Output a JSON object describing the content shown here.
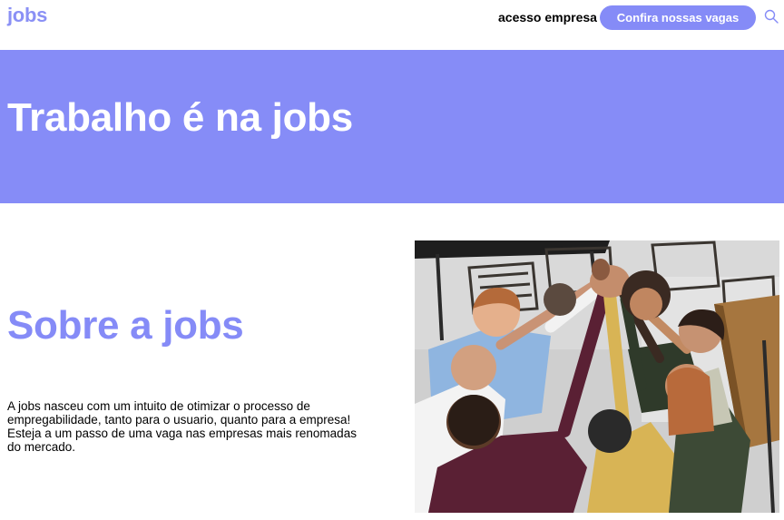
{
  "nav": {
    "logo": "jobs",
    "company_access": "acesso empresa",
    "cta_label": "Confira nossas vagas",
    "search_icon": "search-icon",
    "accent": "#858bf7"
  },
  "hero": {
    "title": "Trabalho é na jobs",
    "background": "#868cf7"
  },
  "about": {
    "title": "Sobre a jobs",
    "paragraph": "A jobs nasceu com um intuito de otimizar o processo de empregabilidade, tanto para o usuario, quanto para a empresa! Esteja a um passo de uma vaga nas empresas mais renomadas do mercado."
  },
  "photo": {
    "description_icon": "team-high-five-photo"
  }
}
